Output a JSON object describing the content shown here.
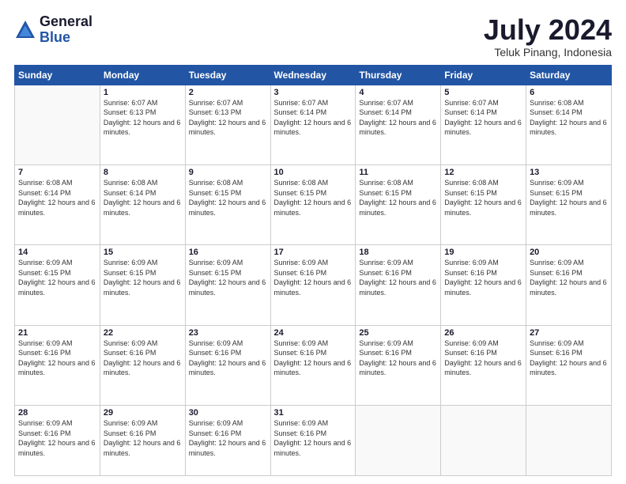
{
  "logo": {
    "general": "General",
    "blue": "Blue"
  },
  "title": {
    "month": "July 2024",
    "location": "Teluk Pinang, Indonesia"
  },
  "weekdays": [
    "Sunday",
    "Monday",
    "Tuesday",
    "Wednesday",
    "Thursday",
    "Friday",
    "Saturday"
  ],
  "weeks": [
    [
      {
        "day": "",
        "sunrise": "",
        "sunset": "",
        "daylight": ""
      },
      {
        "day": "1",
        "sunrise": "Sunrise: 6:07 AM",
        "sunset": "Sunset: 6:13 PM",
        "daylight": "Daylight: 12 hours and 6 minutes."
      },
      {
        "day": "2",
        "sunrise": "Sunrise: 6:07 AM",
        "sunset": "Sunset: 6:13 PM",
        "daylight": "Daylight: 12 hours and 6 minutes."
      },
      {
        "day": "3",
        "sunrise": "Sunrise: 6:07 AM",
        "sunset": "Sunset: 6:14 PM",
        "daylight": "Daylight: 12 hours and 6 minutes."
      },
      {
        "day": "4",
        "sunrise": "Sunrise: 6:07 AM",
        "sunset": "Sunset: 6:14 PM",
        "daylight": "Daylight: 12 hours and 6 minutes."
      },
      {
        "day": "5",
        "sunrise": "Sunrise: 6:07 AM",
        "sunset": "Sunset: 6:14 PM",
        "daylight": "Daylight: 12 hours and 6 minutes."
      },
      {
        "day": "6",
        "sunrise": "Sunrise: 6:08 AM",
        "sunset": "Sunset: 6:14 PM",
        "daylight": "Daylight: 12 hours and 6 minutes."
      }
    ],
    [
      {
        "day": "7",
        "sunrise": "Sunrise: 6:08 AM",
        "sunset": "Sunset: 6:14 PM",
        "daylight": "Daylight: 12 hours and 6 minutes."
      },
      {
        "day": "8",
        "sunrise": "Sunrise: 6:08 AM",
        "sunset": "Sunset: 6:14 PM",
        "daylight": "Daylight: 12 hours and 6 minutes."
      },
      {
        "day": "9",
        "sunrise": "Sunrise: 6:08 AM",
        "sunset": "Sunset: 6:15 PM",
        "daylight": "Daylight: 12 hours and 6 minutes."
      },
      {
        "day": "10",
        "sunrise": "Sunrise: 6:08 AM",
        "sunset": "Sunset: 6:15 PM",
        "daylight": "Daylight: 12 hours and 6 minutes."
      },
      {
        "day": "11",
        "sunrise": "Sunrise: 6:08 AM",
        "sunset": "Sunset: 6:15 PM",
        "daylight": "Daylight: 12 hours and 6 minutes."
      },
      {
        "day": "12",
        "sunrise": "Sunrise: 6:08 AM",
        "sunset": "Sunset: 6:15 PM",
        "daylight": "Daylight: 12 hours and 6 minutes."
      },
      {
        "day": "13",
        "sunrise": "Sunrise: 6:09 AM",
        "sunset": "Sunset: 6:15 PM",
        "daylight": "Daylight: 12 hours and 6 minutes."
      }
    ],
    [
      {
        "day": "14",
        "sunrise": "Sunrise: 6:09 AM",
        "sunset": "Sunset: 6:15 PM",
        "daylight": "Daylight: 12 hours and 6 minutes."
      },
      {
        "day": "15",
        "sunrise": "Sunrise: 6:09 AM",
        "sunset": "Sunset: 6:15 PM",
        "daylight": "Daylight: 12 hours and 6 minutes."
      },
      {
        "day": "16",
        "sunrise": "Sunrise: 6:09 AM",
        "sunset": "Sunset: 6:15 PM",
        "daylight": "Daylight: 12 hours and 6 minutes."
      },
      {
        "day": "17",
        "sunrise": "Sunrise: 6:09 AM",
        "sunset": "Sunset: 6:16 PM",
        "daylight": "Daylight: 12 hours and 6 minutes."
      },
      {
        "day": "18",
        "sunrise": "Sunrise: 6:09 AM",
        "sunset": "Sunset: 6:16 PM",
        "daylight": "Daylight: 12 hours and 6 minutes."
      },
      {
        "day": "19",
        "sunrise": "Sunrise: 6:09 AM",
        "sunset": "Sunset: 6:16 PM",
        "daylight": "Daylight: 12 hours and 6 minutes."
      },
      {
        "day": "20",
        "sunrise": "Sunrise: 6:09 AM",
        "sunset": "Sunset: 6:16 PM",
        "daylight": "Daylight: 12 hours and 6 minutes."
      }
    ],
    [
      {
        "day": "21",
        "sunrise": "Sunrise: 6:09 AM",
        "sunset": "Sunset: 6:16 PM",
        "daylight": "Daylight: 12 hours and 6 minutes."
      },
      {
        "day": "22",
        "sunrise": "Sunrise: 6:09 AM",
        "sunset": "Sunset: 6:16 PM",
        "daylight": "Daylight: 12 hours and 6 minutes."
      },
      {
        "day": "23",
        "sunrise": "Sunrise: 6:09 AM",
        "sunset": "Sunset: 6:16 PM",
        "daylight": "Daylight: 12 hours and 6 minutes."
      },
      {
        "day": "24",
        "sunrise": "Sunrise: 6:09 AM",
        "sunset": "Sunset: 6:16 PM",
        "daylight": "Daylight: 12 hours and 6 minutes."
      },
      {
        "day": "25",
        "sunrise": "Sunrise: 6:09 AM",
        "sunset": "Sunset: 6:16 PM",
        "daylight": "Daylight: 12 hours and 6 minutes."
      },
      {
        "day": "26",
        "sunrise": "Sunrise: 6:09 AM",
        "sunset": "Sunset: 6:16 PM",
        "daylight": "Daylight: 12 hours and 6 minutes."
      },
      {
        "day": "27",
        "sunrise": "Sunrise: 6:09 AM",
        "sunset": "Sunset: 6:16 PM",
        "daylight": "Daylight: 12 hours and 6 minutes."
      }
    ],
    [
      {
        "day": "28",
        "sunrise": "Sunrise: 6:09 AM",
        "sunset": "Sunset: 6:16 PM",
        "daylight": "Daylight: 12 hours and 6 minutes."
      },
      {
        "day": "29",
        "sunrise": "Sunrise: 6:09 AM",
        "sunset": "Sunset: 6:16 PM",
        "daylight": "Daylight: 12 hours and 6 minutes."
      },
      {
        "day": "30",
        "sunrise": "Sunrise: 6:09 AM",
        "sunset": "Sunset: 6:16 PM",
        "daylight": "Daylight: 12 hours and 6 minutes."
      },
      {
        "day": "31",
        "sunrise": "Sunrise: 6:09 AM",
        "sunset": "Sunset: 6:16 PM",
        "daylight": "Daylight: 12 hours and 6 minutes."
      },
      {
        "day": "",
        "sunrise": "",
        "sunset": "",
        "daylight": ""
      },
      {
        "day": "",
        "sunrise": "",
        "sunset": "",
        "daylight": ""
      },
      {
        "day": "",
        "sunrise": "",
        "sunset": "",
        "daylight": ""
      }
    ]
  ]
}
